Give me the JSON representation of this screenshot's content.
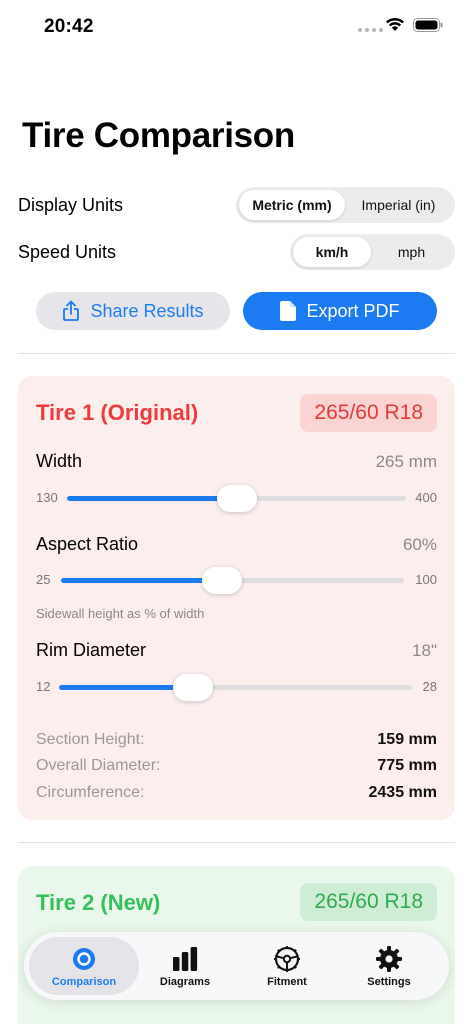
{
  "status_bar": {
    "time": "20:42"
  },
  "title": "Tire Comparison",
  "display_units": {
    "label": "Display Units",
    "options": [
      "Metric (mm)",
      "Imperial (in)"
    ],
    "selected": "Metric (mm)"
  },
  "speed_units": {
    "label": "Speed Units",
    "options": [
      "km/h",
      "mph"
    ],
    "selected": "km/h"
  },
  "actions": {
    "share": "Share Results",
    "export": "Export PDF"
  },
  "colors": {
    "accent": "#1a7cf0",
    "tire1": "#ee3b3b",
    "tire2": "#34c15a"
  },
  "tire1": {
    "title": "Tire 1 (Original)",
    "badge": "265/60 R18",
    "width": {
      "label": "Width",
      "value": "265 mm",
      "min": "130",
      "max": "400",
      "fraction": 0.5
    },
    "aspect": {
      "label": "Aspect Ratio",
      "value": "60%",
      "min": "25",
      "max": "100",
      "fraction": 0.47,
      "hint": "Sidewall height as % of width"
    },
    "rim": {
      "label": "Rim Diameter",
      "value": "18\"",
      "min": "12",
      "max": "28",
      "fraction": 0.38
    },
    "stats": [
      {
        "label": "Section Height:",
        "value": "159 mm"
      },
      {
        "label": "Overall Diameter:",
        "value": "775 mm"
      },
      {
        "label": "Circumference:",
        "value": "2435 mm"
      }
    ]
  },
  "tire2": {
    "title": "Tire 2 (New)",
    "badge": "265/60 R18"
  },
  "tabs": [
    {
      "label": "Comparison",
      "icon": "circle-icon",
      "active": true
    },
    {
      "label": "Diagrams",
      "icon": "bar-chart-icon",
      "active": false
    },
    {
      "label": "Fitment",
      "icon": "steering-wheel-icon",
      "active": false
    },
    {
      "label": "Settings",
      "icon": "gear-icon",
      "active": false
    }
  ]
}
